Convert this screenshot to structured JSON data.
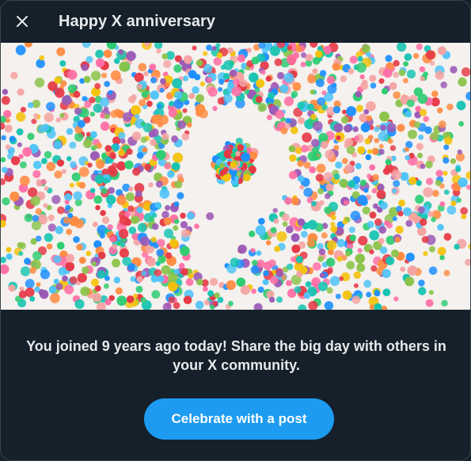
{
  "dialog": {
    "title": "Happy X anniversary",
    "close_icon": "close-icon",
    "hero_image": {
      "number": "9",
      "description_icon": "confetti-nine-illustration"
    },
    "message": "You joined 9 years ago today! Share the big day with others in your X community.",
    "cta_label": "Celebrate with a post"
  },
  "colors": {
    "background": "#15202b",
    "accent": "#1d9bf0",
    "text": "#e7e9ea",
    "confetti": [
      "#e63946",
      "#f4c20d",
      "#2ecc71",
      "#1e90ff",
      "#9b59b6",
      "#ff8c42",
      "#ff6fa5",
      "#17c3b2",
      "#8bc34a",
      "#f5a3a3",
      "#4fc3f7"
    ]
  }
}
